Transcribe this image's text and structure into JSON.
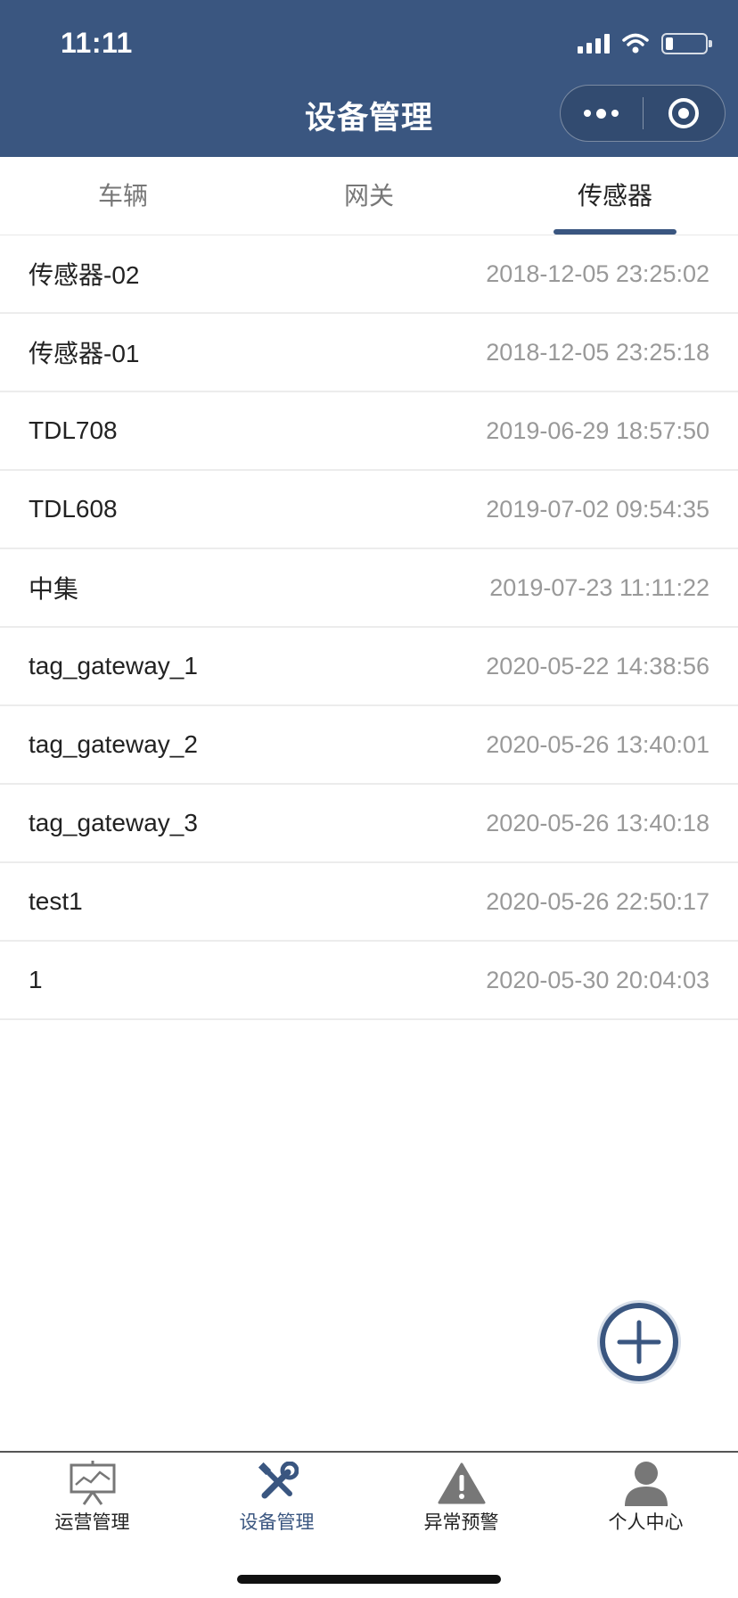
{
  "status_bar": {
    "time": "11:11"
  },
  "nav": {
    "title": "设备管理"
  },
  "tabs": [
    {
      "label": "车辆",
      "active": false
    },
    {
      "label": "网关",
      "active": false
    },
    {
      "label": "传感器",
      "active": true
    }
  ],
  "devices": [
    {
      "name": "传感器-02",
      "time": "2018-12-05 23:25:02"
    },
    {
      "name": "传感器-01",
      "time": "2018-12-05 23:25:18"
    },
    {
      "name": "TDL708",
      "time": "2019-06-29 18:57:50"
    },
    {
      "name": "TDL608",
      "time": "2019-07-02 09:54:35"
    },
    {
      "name": "中集",
      "time": "2019-07-23 11:11:22"
    },
    {
      "name": "tag_gateway_1",
      "time": "2020-05-22 14:38:56"
    },
    {
      "name": "tag_gateway_2",
      "time": "2020-05-26 13:40:01"
    },
    {
      "name": "tag_gateway_3",
      "time": "2020-05-26 13:40:18"
    },
    {
      "name": "test1",
      "time": "2020-05-26 22:50:17"
    },
    {
      "name": "1",
      "time": "2020-05-30 20:04:03"
    }
  ],
  "tabbar": [
    {
      "label": "运营管理",
      "icon": "chart-board-icon",
      "active": false
    },
    {
      "label": "设备管理",
      "icon": "tools-icon",
      "active": true
    },
    {
      "label": "异常预警",
      "icon": "warning-icon",
      "active": false
    },
    {
      "label": "个人中心",
      "icon": "person-icon",
      "active": false
    }
  ],
  "colors": {
    "primary": "#3a5680",
    "text": "#222222",
    "muted": "#999999"
  }
}
